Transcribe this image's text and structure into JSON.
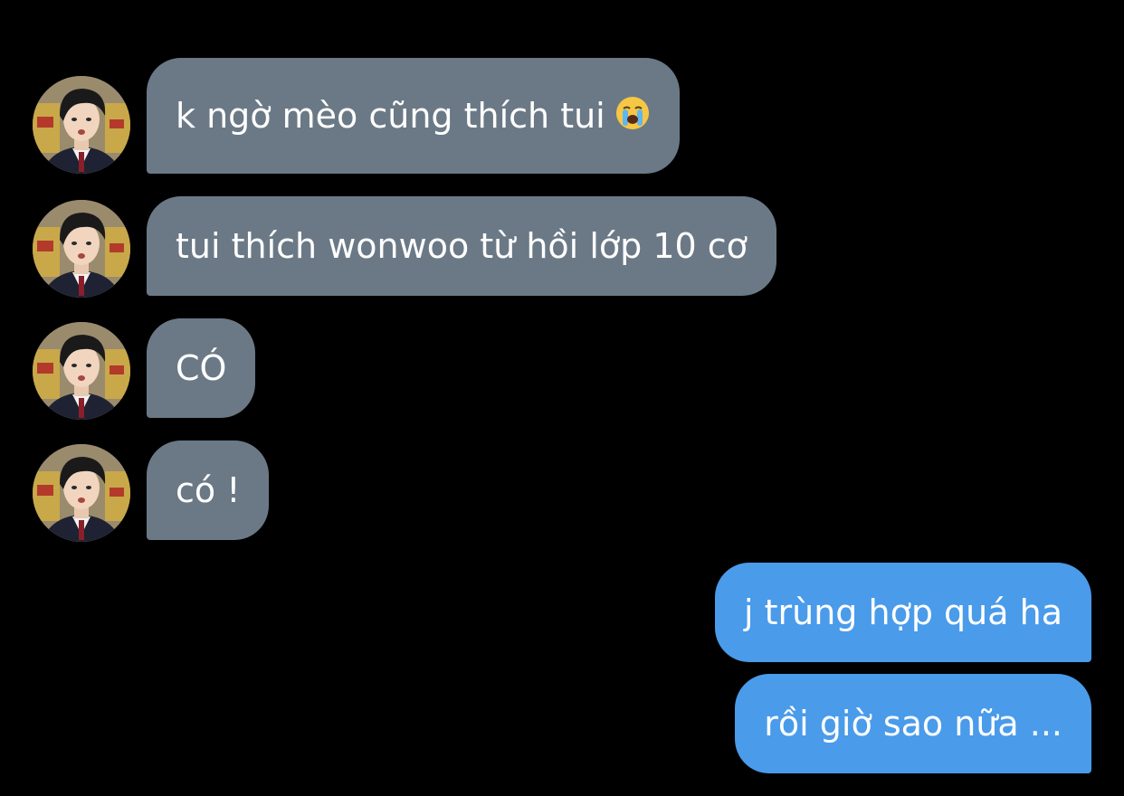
{
  "conversation": {
    "incoming": [
      {
        "text": "k ngờ mèo cũng thích tui",
        "emoji_icon": "loudly-crying-face-icon"
      },
      {
        "text": "tui thích wonwoo từ hồi lớp 10 cơ"
      },
      {
        "text": "CÓ"
      },
      {
        "text": "có !"
      }
    ],
    "outgoing": [
      {
        "text": "j trùng hợp quá ha"
      },
      {
        "text": "rồi giờ sao nữa ..."
      }
    ]
  },
  "colors": {
    "background": "#000000",
    "incoming_bubble": "#6b7986",
    "outgoing_bubble": "#4a9bea",
    "text": "#ffffff"
  }
}
